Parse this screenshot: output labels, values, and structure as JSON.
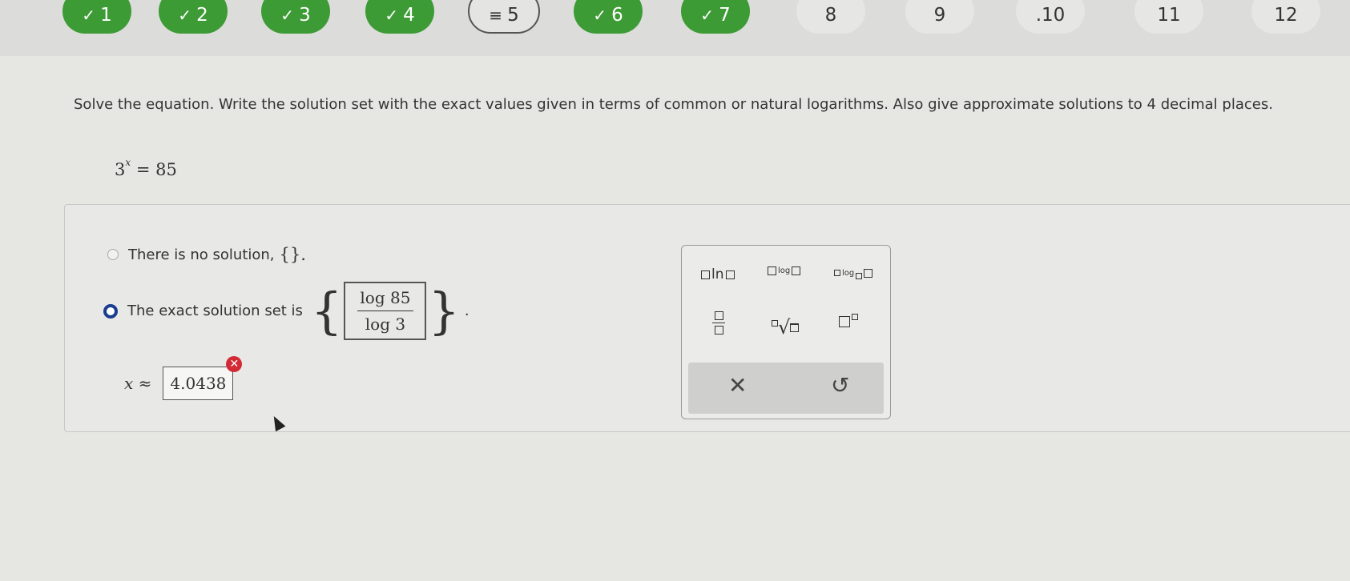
{
  "nav": {
    "questions": [
      {
        "label": "1",
        "status": "correct",
        "icon": "check-icon"
      },
      {
        "label": "2",
        "status": "correct",
        "icon": "check-icon"
      },
      {
        "label": "3",
        "status": "correct",
        "icon": "check-icon"
      },
      {
        "label": "4",
        "status": "correct",
        "icon": "check-icon"
      },
      {
        "label": "5",
        "status": "partial",
        "icon": "equals-icon"
      },
      {
        "label": "6",
        "status": "correct",
        "icon": "check-icon"
      },
      {
        "label": "7",
        "status": "correct",
        "icon": "check-icon"
      },
      {
        "label": "8",
        "status": "open"
      },
      {
        "label": "9",
        "status": "open"
      },
      {
        "label": ".10",
        "status": "open"
      },
      {
        "label": "11",
        "status": "open"
      },
      {
        "label": "12",
        "status": "open"
      }
    ],
    "correct_color": "#3d9b35"
  },
  "question": {
    "instruction": "Solve the equation. Write the solution set with the exact values given in terms of common or natural logarithms. Also give approximate solutions to 4 decimal places.",
    "equation_base": "3",
    "equation_exponent": "x",
    "equation_rhs": "= 85"
  },
  "answer": {
    "option_no_solution": "There is no solution,",
    "option_no_solution_set": "{}.",
    "option_exact": "The exact solution set is",
    "exact_numerator": "log 85",
    "exact_denominator": "log 3",
    "exact_trailing": ".",
    "selected_option": "exact",
    "approx_label": "x ≈",
    "approx_value": "4.0438",
    "approx_status": "incorrect",
    "error_color": "#d32b36"
  },
  "palette": {
    "ln_label": "ln",
    "log_label": "log",
    "logb_label": "log",
    "clear_symbol": "✕",
    "undo_symbol": "↺"
  }
}
